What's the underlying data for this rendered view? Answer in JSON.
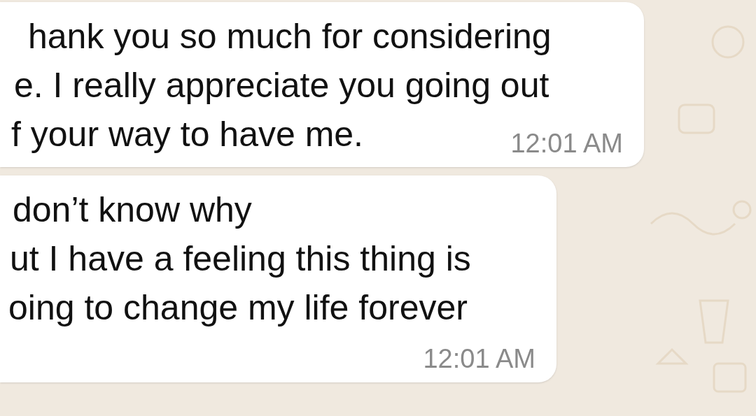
{
  "messages": [
    {
      "lines": [
        "hank you so much for considering",
        "e. I really appreciate you going out",
        "f your way to have me."
      ],
      "time": "12:01 AM"
    },
    {
      "lines": [
        "don’t know why",
        "ut I have a feeling this thing is",
        "oing to change my life forever"
      ],
      "time": "12:01 AM"
    }
  ]
}
